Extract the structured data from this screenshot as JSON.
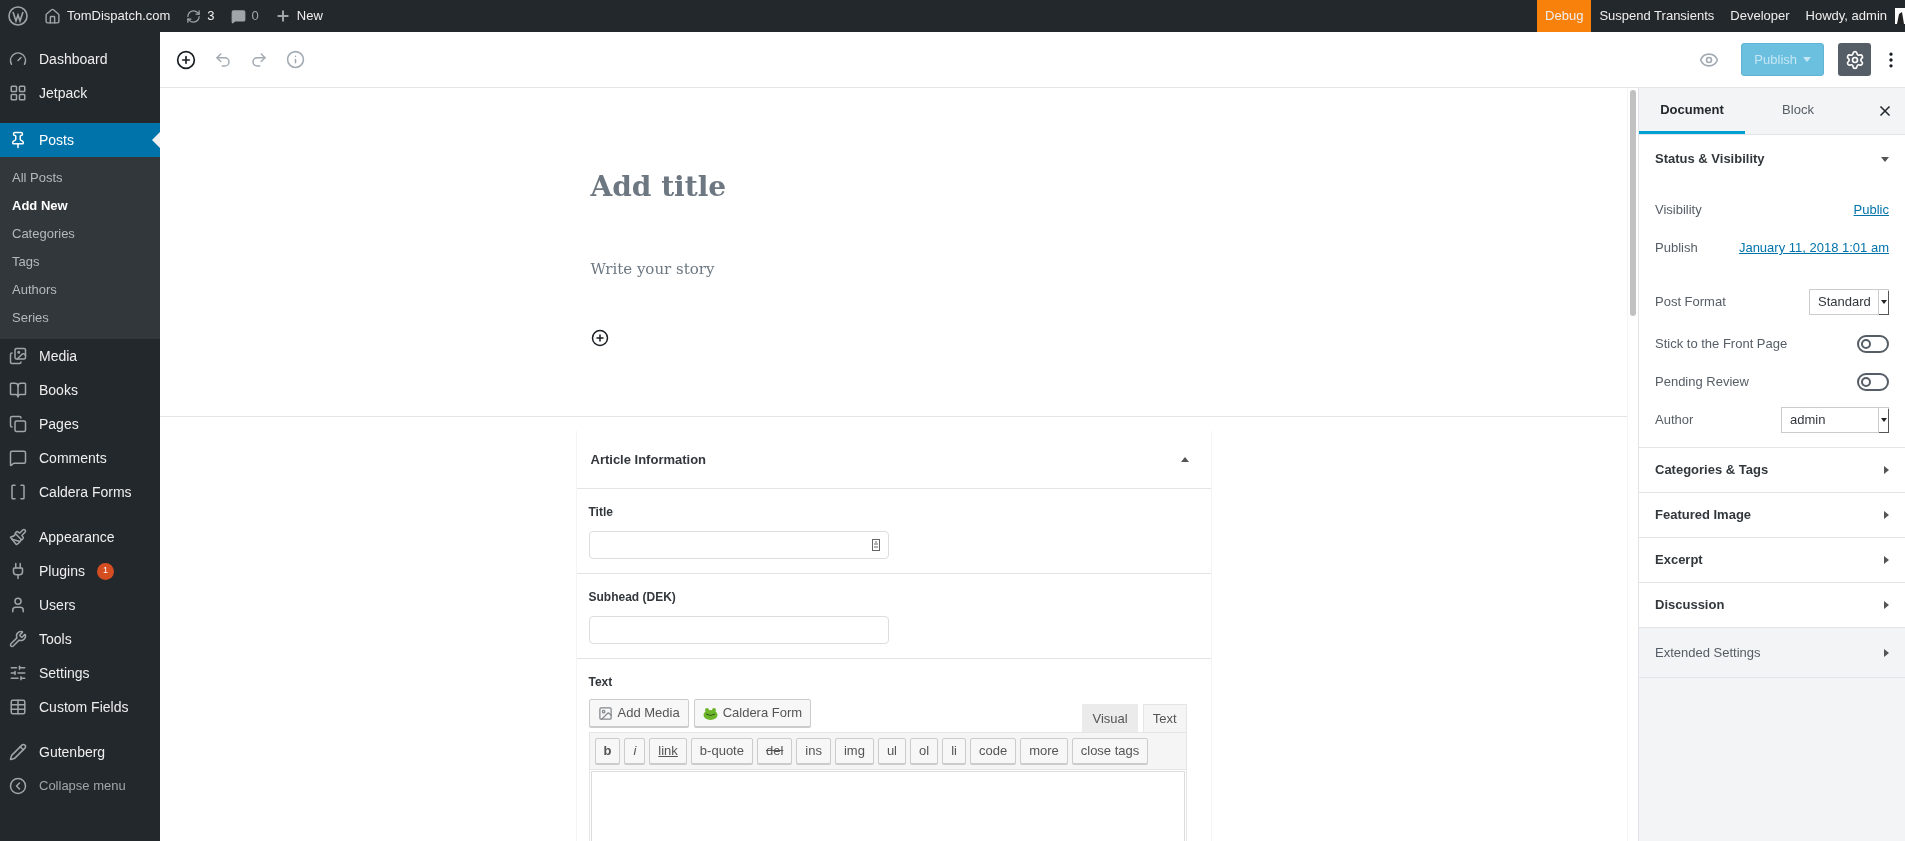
{
  "admin_bar": {
    "site": "TomDispatch.com",
    "updates": "3",
    "comments": "0",
    "new": "New",
    "right": [
      {
        "label": "Debug",
        "selected": true
      },
      {
        "label": "Suspend Transients",
        "selected": false
      },
      {
        "label": "Developer",
        "selected": false
      }
    ],
    "greeting": "Howdy, admin"
  },
  "sidebar": {
    "groups": [
      {
        "items": [
          {
            "label": "Dashboard",
            "selected": false
          },
          {
            "label": "Jetpack",
            "selected": false
          }
        ]
      },
      {
        "items": [
          {
            "label": "Posts",
            "selected": true,
            "children": [
              {
                "label": "All Posts",
                "selected": false
              },
              {
                "label": "Add New",
                "selected": true
              },
              {
                "label": "Categories",
                "selected": false
              },
              {
                "label": "Tags",
                "selected": false
              },
              {
                "label": "Authors",
                "selected": false
              },
              {
                "label": "Series",
                "selected": false
              }
            ]
          },
          {
            "label": "Media",
            "selected": false
          },
          {
            "label": "Books",
            "selected": false
          },
          {
            "label": "Pages",
            "selected": false
          },
          {
            "label": "Comments",
            "selected": false
          },
          {
            "label": "Caldera Forms",
            "selected": false
          }
        ]
      },
      {
        "items": [
          {
            "label": "Appearance",
            "selected": false
          },
          {
            "label": "Plugins",
            "selected": false,
            "badge": "1"
          },
          {
            "label": "Users",
            "selected": false
          },
          {
            "label": "Tools",
            "selected": false
          },
          {
            "label": "Settings",
            "selected": false
          },
          {
            "label": "Custom Fields",
            "selected": false
          }
        ]
      },
      {
        "items": [
          {
            "label": "Gutenberg",
            "selected": false
          },
          {
            "label": "Collapse menu",
            "selected": false,
            "kind": "collapse"
          }
        ]
      }
    ]
  },
  "toolbar": {
    "publish": {
      "label": "Publish",
      "disabled": true
    }
  },
  "editor": {
    "title_placeholder": "Add title",
    "body_placeholder": "Write your story"
  },
  "meta_box": {
    "title": "Article Information",
    "expanded": true,
    "fields": [
      {
        "label": "Title"
      },
      {
        "label": "Subhead (DEK)"
      }
    ],
    "text_label": "Text",
    "media_buttons": [
      "Add Media",
      "Caldera Form"
    ],
    "mode_tabs": [
      {
        "label": "Visual",
        "selected": false
      },
      {
        "label": "Text",
        "selected": true
      }
    ],
    "quicktags": [
      {
        "label": "b",
        "kind": "bold"
      },
      {
        "label": "i",
        "kind": "italic"
      },
      {
        "label": "link",
        "kind": "underline"
      },
      {
        "label": "b-quote",
        "kind": "plain"
      },
      {
        "label": "del",
        "kind": "strike"
      },
      {
        "label": "ins",
        "kind": "plain"
      },
      {
        "label": "img",
        "kind": "plain"
      },
      {
        "label": "ul",
        "kind": "plain"
      },
      {
        "label": "ol",
        "kind": "plain"
      },
      {
        "label": "li",
        "kind": "plain"
      },
      {
        "label": "code",
        "kind": "plain"
      },
      {
        "label": "more",
        "kind": "plain"
      },
      {
        "label": "close tags",
        "kind": "plain"
      }
    ]
  },
  "settings_panel": {
    "tabs": [
      {
        "label": "Document",
        "selected": true
      },
      {
        "label": "Block",
        "selected": false
      }
    ],
    "status": {
      "title": "Status & Visibility",
      "expanded": true,
      "rows": [
        {
          "label": "Visibility",
          "kind": "link",
          "value": "Public"
        },
        {
          "label": "Publish",
          "kind": "link",
          "value": "January 11, 2018 1:01 am"
        },
        {
          "label": "Post Format",
          "kind": "select",
          "value": "Standard"
        },
        {
          "label": "Stick to the Front Page",
          "kind": "toggle",
          "on": false
        },
        {
          "label": "Pending Review",
          "kind": "toggle",
          "on": false
        },
        {
          "label": "Author",
          "kind": "select",
          "value": "admin"
        }
      ]
    },
    "sections": [
      {
        "title": "Categories & Tags",
        "expanded": false
      },
      {
        "title": "Featured Image",
        "expanded": false
      },
      {
        "title": "Excerpt",
        "expanded": false
      },
      {
        "title": "Discussion",
        "expanded": false
      }
    ],
    "extended": {
      "title": "Extended Settings",
      "expanded": false
    }
  }
}
